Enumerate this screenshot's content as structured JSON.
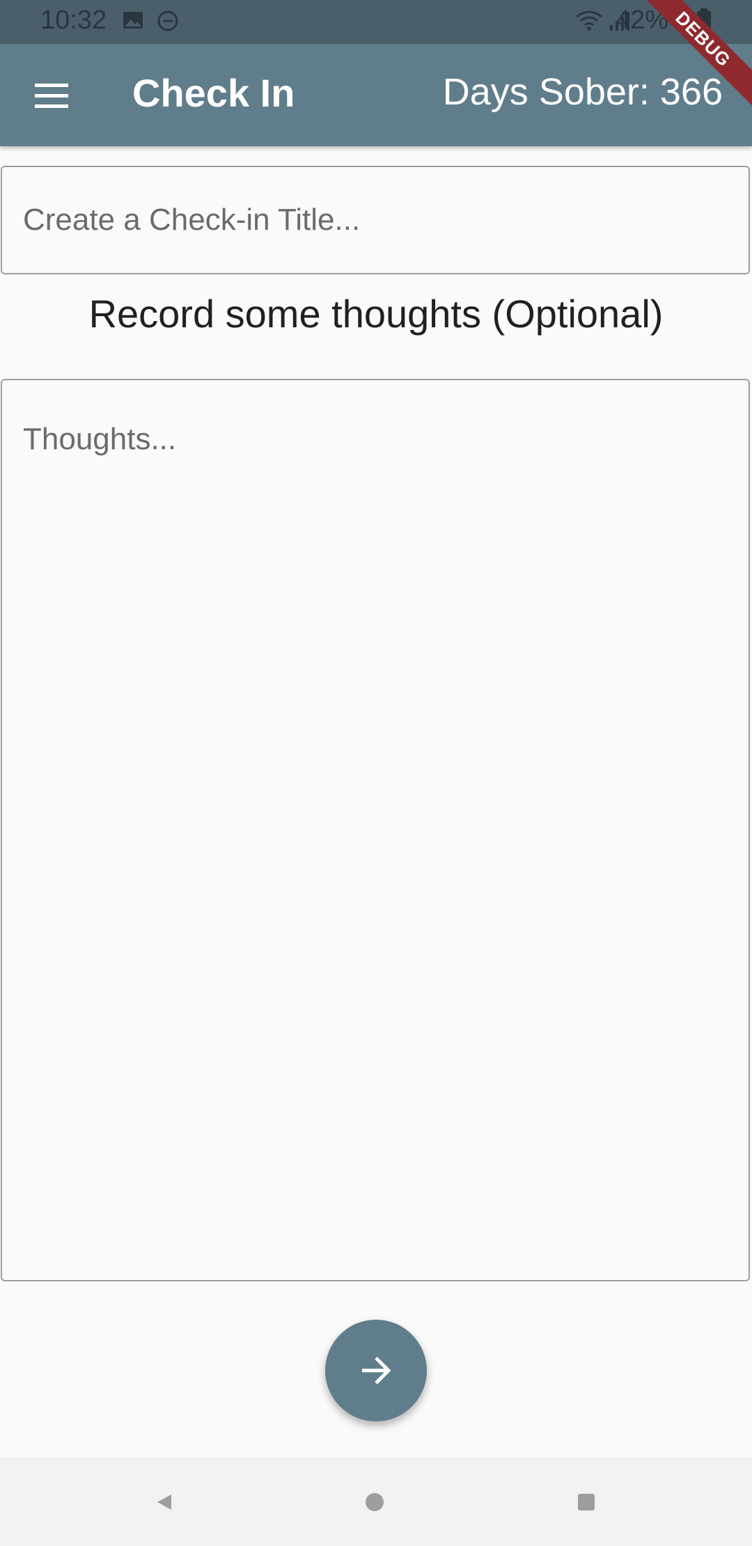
{
  "status_bar": {
    "time": "10:32",
    "battery": "42%"
  },
  "app_bar": {
    "title": "Check In",
    "days_sober": "Days Sober: 366",
    "debug_label": "DEBUG"
  },
  "form": {
    "title_placeholder": "Create a Check-in Title...",
    "title_value": "",
    "heading": "Record some thoughts (Optional)",
    "thoughts_placeholder": "Thoughts...",
    "thoughts_value": ""
  },
  "colors": {
    "primary": "#607d8b",
    "debug_ribbon": "#8e2a2d"
  }
}
